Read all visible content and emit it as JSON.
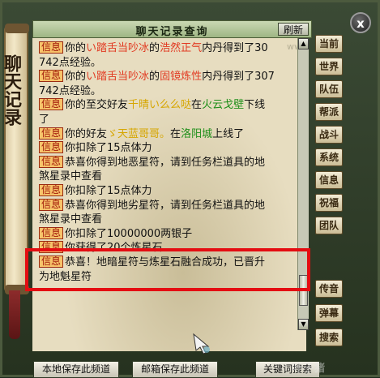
{
  "window": {
    "title": "聊天记录查询",
    "refresh_label": "刷新",
    "close_label": "x",
    "side_title": "聊天记录"
  },
  "messages": [
    {
      "tag": "信息",
      "parts": [
        [
          "你的",
          ""
        ],
        [
          "い踏舌当吵冰",
          "red"
        ],
        [
          "的",
          ""
        ],
        [
          "浩然正气",
          "red"
        ],
        [
          "内丹得到了30",
          ""
        ]
      ]
    },
    {
      "tag": "",
      "parts": [
        [
          "742点经验。",
          ""
        ]
      ]
    },
    {
      "tag": "信息",
      "parts": [
        [
          "你的",
          ""
        ],
        [
          "い踏舌当吵冰",
          "red"
        ],
        [
          "的",
          ""
        ],
        [
          "固镜炼性",
          "red"
        ],
        [
          "内丹得到了307",
          ""
        ]
      ]
    },
    {
      "tag": "",
      "parts": [
        [
          "742点经验。",
          ""
        ]
      ]
    },
    {
      "tag": "信息",
      "parts": [
        [
          "你的至交好友",
          ""
        ],
        [
          "千晴い么么哒",
          "yellow"
        ],
        [
          "在",
          ""
        ],
        [
          "火云戈壁",
          "green"
        ],
        [
          "下线",
          ""
        ]
      ]
    },
    {
      "tag": "",
      "parts": [
        [
          "了",
          ""
        ]
      ]
    },
    {
      "tag": "信息",
      "parts": [
        [
          "你的好友",
          ""
        ],
        [
          "ゞ天蓝哥哥。",
          "yellow"
        ],
        [
          "在",
          ""
        ],
        [
          "洛阳城",
          "green"
        ],
        [
          "上线了",
          ""
        ]
      ]
    },
    {
      "tag": "信息",
      "parts": [
        [
          "你扣除了15点体力",
          ""
        ]
      ]
    },
    {
      "tag": "信息",
      "parts": [
        [
          "恭喜你得到地恶星符，请到任务栏道具的地",
          ""
        ]
      ]
    },
    {
      "tag": "",
      "parts": [
        [
          "煞星录中查看",
          ""
        ]
      ]
    },
    {
      "tag": "信息",
      "parts": [
        [
          "你扣除了15点体力",
          ""
        ]
      ]
    },
    {
      "tag": "信息",
      "parts": [
        [
          "恭喜你得到地劣星符，请到任务栏道具的地",
          ""
        ]
      ]
    },
    {
      "tag": "",
      "parts": [
        [
          "煞星录中查看",
          ""
        ]
      ]
    },
    {
      "tag": "信息",
      "parts": [
        [
          "你扣除了10000000两银子",
          ""
        ]
      ]
    },
    {
      "tag": "信息",
      "parts": [
        [
          "你获得了20个炼星石",
          ""
        ]
      ]
    },
    {
      "tag": "信息",
      "parts": [
        [
          "恭喜！地暗星符与炼星石融合成功，已晋升",
          ""
        ]
      ]
    },
    {
      "tag": "",
      "parts": [
        [
          "为地魁星符",
          ""
        ]
      ]
    }
  ],
  "channels_top": [
    "当前",
    "世界",
    "队伍",
    "帮派",
    "战斗",
    "系统",
    "信息",
    "祝福",
    "团队"
  ],
  "channels_bottom": [
    "传音",
    "弹幕",
    "搜索"
  ],
  "bottom_buttons": {
    "save_local": "本地保存此频道",
    "mail_save": "邮箱保存此频道",
    "keyword_search": "关键词搜索"
  },
  "watermarks": {
    "chat": "www.YZZ.Cn",
    "corner": "叶子猪"
  },
  "colors": {
    "highlight_border": "#e40d12",
    "tag_text": "#a31b0b",
    "player_name": "#e23a22",
    "location": "#1f8f1a"
  }
}
